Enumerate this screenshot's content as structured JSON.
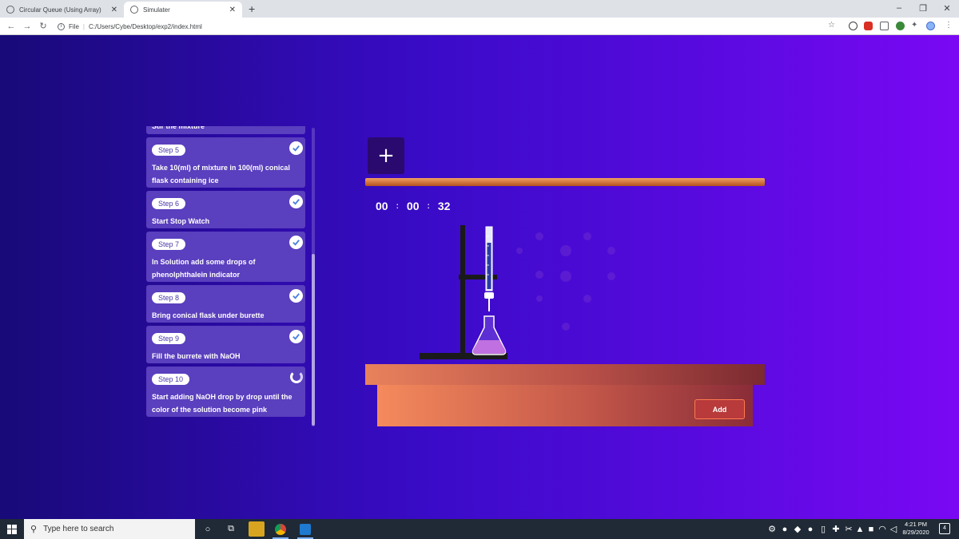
{
  "browser": {
    "tabs": [
      {
        "title": "Circular Queue (Using Array)",
        "active": false
      },
      {
        "title": "Simulater",
        "active": true
      }
    ],
    "new_tab": "+",
    "address": {
      "scheme_label": "File",
      "url": "C:/Users/Cybe/Desktop/exp2/index.html"
    },
    "window_controls": [
      "–",
      "❐",
      "✕"
    ]
  },
  "steps": [
    {
      "label": "",
      "text": "Stir the mixture",
      "status": "done",
      "partial": true
    },
    {
      "label": "Step 5",
      "text": "Take 10(ml) of mixture in 100(ml) conical flask containing ice",
      "status": "done"
    },
    {
      "label": "Step 6",
      "text": "Start Stop Watch",
      "status": "done"
    },
    {
      "label": "Step 7",
      "text": "In Solution add some drops of phenolphthalein indicator",
      "status": "done"
    },
    {
      "label": "Step 8",
      "text": "Bring conical flask under burette",
      "status": "done"
    },
    {
      "label": "Step 9",
      "text": "Fill the burrete with NaOH",
      "status": "done"
    },
    {
      "label": "Step 10",
      "text": "Start adding NaOH drop by drop until the color of the solution become pink",
      "status": "in-progress"
    }
  ],
  "toolbar": {
    "add_tool_label": "+"
  },
  "timer": {
    "hours": "00",
    "minutes": "00",
    "seconds": "32",
    "separator": ":"
  },
  "bench": {
    "add_label": "Add"
  },
  "taskbar": {
    "search_placeholder": "Type here to search",
    "time": "4:21 PM",
    "date": "8/29/2020",
    "notification_count": "4"
  },
  "colors": {
    "page_gradient_start": "#180a78",
    "page_gradient_end": "#7a08f4",
    "step_card": "#5a3fbe",
    "shelf": "#d06a38",
    "flask_liquid": "#c070e0"
  }
}
